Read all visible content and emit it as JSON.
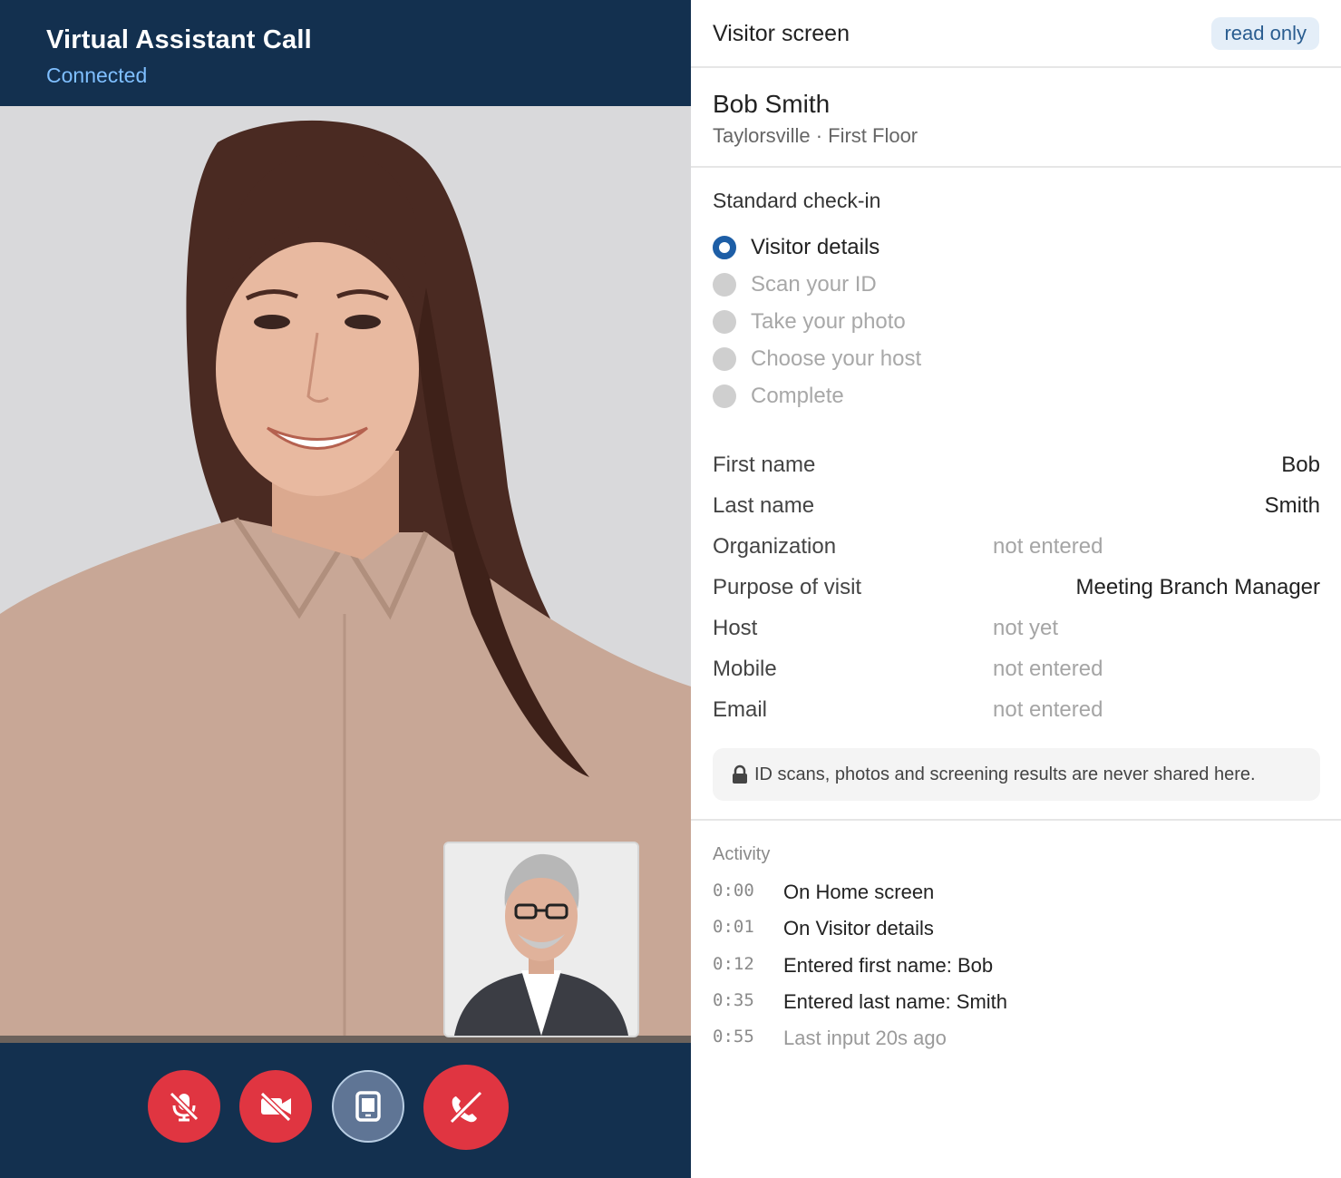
{
  "call": {
    "title": "Virtual Assistant Call",
    "status": "Connected",
    "controls": [
      {
        "name": "mute-mic",
        "icon": "mic-off-icon",
        "state": "off"
      },
      {
        "name": "camera",
        "icon": "video-off-icon",
        "state": "off"
      },
      {
        "name": "share-screen",
        "icon": "tablet-icon",
        "state": "active"
      },
      {
        "name": "hang-up",
        "icon": "phone-hangup-icon",
        "state": "danger"
      }
    ]
  },
  "panel": {
    "title": "Visitor screen",
    "badge": "read only",
    "visitor": {
      "name": "Bob Smith",
      "location": "Taylorsville · First Floor"
    },
    "flow": {
      "title": "Standard check-in",
      "steps": [
        {
          "label": "Visitor details",
          "active": true
        },
        {
          "label": "Scan your ID",
          "active": false
        },
        {
          "label": "Take your photo",
          "active": false
        },
        {
          "label": "Choose your host",
          "active": false
        },
        {
          "label": "Complete",
          "active": false
        }
      ]
    },
    "fields": [
      {
        "label": "First name",
        "value": "Bob",
        "filled": true
      },
      {
        "label": "Last name",
        "value": "Smith",
        "filled": true
      },
      {
        "label": "Organization",
        "value": "not entered",
        "filled": false
      },
      {
        "label": "Purpose of visit",
        "value": "Meeting Branch Manager",
        "filled": true
      },
      {
        "label": "Host",
        "value": "not yet",
        "filled": false
      },
      {
        "label": "Mobile",
        "value": "not entered",
        "filled": false
      },
      {
        "label": "Email",
        "value": "not entered",
        "filled": false
      }
    ],
    "notice": "ID scans, photos and screening results are never shared here.",
    "activity": {
      "title": "Activity",
      "items": [
        {
          "time": "0:00",
          "event": "On Home screen",
          "muted": false
        },
        {
          "time": "0:01",
          "event": "On Visitor details",
          "muted": false
        },
        {
          "time": "0:12",
          "event": "Entered first name: Bob",
          "muted": false
        },
        {
          "time": "0:35",
          "event": "Entered last name: Smith",
          "muted": false
        },
        {
          "time": "0:55",
          "event": "Last input 20s ago",
          "muted": true
        }
      ]
    }
  },
  "colors": {
    "navy": "#13304f",
    "connected": "#7fbfff",
    "danger": "#e03541",
    "active_step": "#1d5ea6",
    "badge_bg": "#e4eef8"
  }
}
